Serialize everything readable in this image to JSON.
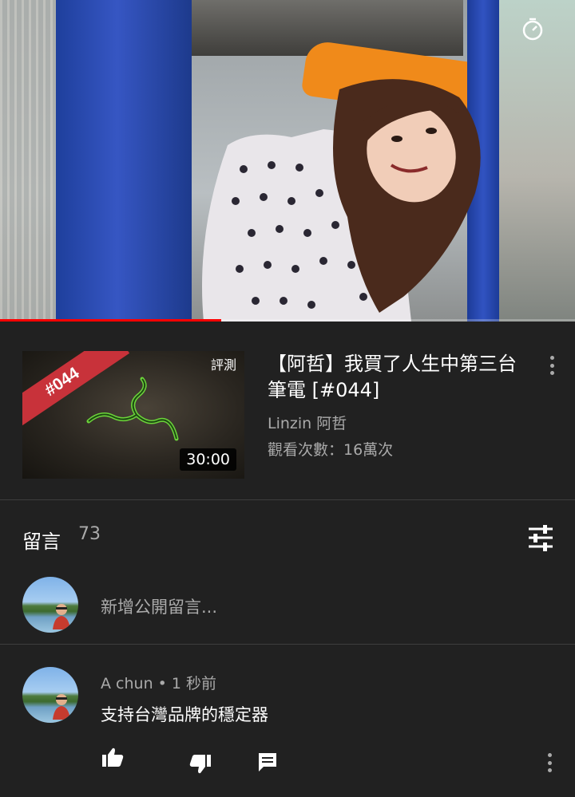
{
  "player": {
    "progress_fraction": 0.385,
    "progress_color": "#ff0000",
    "timer_icon": "timer-icon"
  },
  "now_playing": {
    "thumbnail": {
      "corner_badge": "#044",
      "tag": "評測",
      "duration": "30:00",
      "logo_icon": "three-headed-snake-logo"
    },
    "title": "【阿哲】我買了人生中第三台筆電 [#044]",
    "channel": "Linzin 阿哲",
    "views": "觀看次數：16萬次",
    "menu_icon": "more-vert-icon"
  },
  "comments": {
    "title": "留言",
    "count": "73",
    "sort_icon": "tune-icon",
    "add_placeholder": "新增公開留言...",
    "items": [
      {
        "author": "A chun",
        "separator": "•",
        "time": "1 秒前",
        "text": "支持台灣品牌的穩定器",
        "actions": [
          "thumb-up-icon",
          "thumb-down-icon",
          "reply-comment-icon",
          "more-vert-icon"
        ]
      }
    ]
  }
}
